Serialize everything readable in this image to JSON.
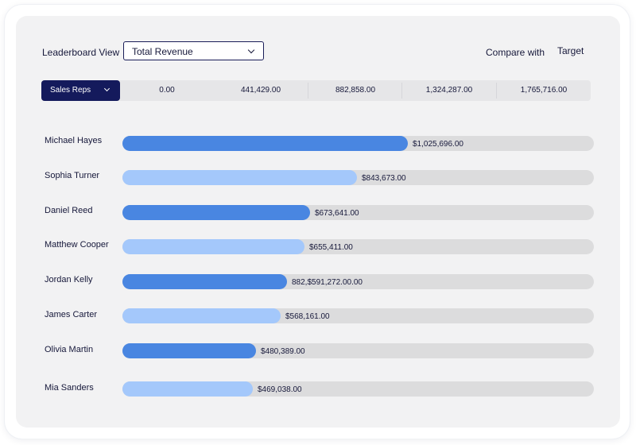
{
  "header": {
    "view_label": "Leaderboard View",
    "metric_selected": "Total Revenue",
    "compare_label": "Compare with",
    "compare_value": "Target"
  },
  "axis": {
    "group_label": "Sales Reps",
    "ticks": [
      "0.00",
      "441,429.00",
      "882,858.00",
      "1,324,287.00",
      "1,765,716.00"
    ]
  },
  "colors": {
    "bar_primary": "#4986e1",
    "bar_secondary": "#a4c8fb",
    "track": "#dcdcdd",
    "accent": "#141a5c"
  },
  "chart_data": {
    "type": "bar",
    "orientation": "horizontal",
    "categories": [
      "Michael Hayes",
      "Sophia Turner",
      "Daniel Reed",
      "Matthew Cooper",
      "Jordan Kelly",
      "James Carter",
      "Olivia Martin",
      "Mia Sanders"
    ],
    "values": [
      1025696,
      843673,
      673641,
      655411,
      591272,
      568161,
      480389,
      469038
    ],
    "value_labels": [
      "$1,025,696.00",
      "$843,673.00",
      "$673,641.00",
      "$655,411.00",
      "882,$591,272.00.00",
      "$568,161.00",
      "$480,389.00",
      "$469,038.00"
    ],
    "xlim": [
      0,
      1765716
    ],
    "xticks": [
      0,
      441429,
      882858,
      1324287,
      1765716
    ],
    "grid": false,
    "legend": "none"
  }
}
